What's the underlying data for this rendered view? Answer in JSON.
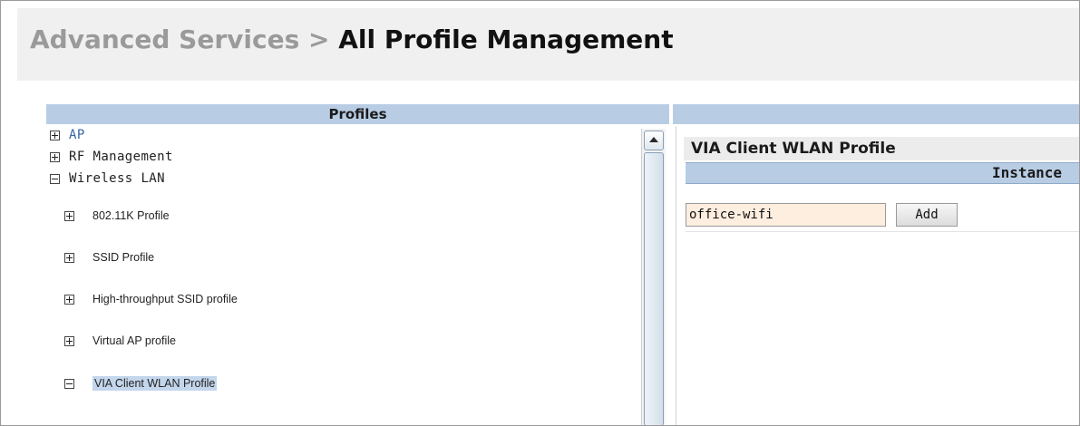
{
  "header": {
    "breadcrumb_parent": "Advanced Services",
    "breadcrumb_separator": ">",
    "breadcrumb_current": "All Profile Management"
  },
  "profiles": {
    "header": "Profiles",
    "tree": [
      {
        "label": "AP",
        "state": "collapsed",
        "level": 0,
        "link": true
      },
      {
        "label": "RF Management",
        "state": "collapsed",
        "level": 0
      },
      {
        "label": "Wireless LAN",
        "state": "expanded",
        "level": 0
      },
      {
        "label": "802.11K Profile",
        "state": "collapsed",
        "level": 1
      },
      {
        "label": "SSID Profile",
        "state": "collapsed",
        "level": 1
      },
      {
        "label": "High-throughput SSID profile",
        "state": "collapsed",
        "level": 1
      },
      {
        "label": "Virtual AP profile",
        "state": "collapsed",
        "level": 1
      },
      {
        "label": "VIA Client WLAN Profile",
        "state": "expanded",
        "level": 1,
        "selected": true
      }
    ]
  },
  "detail": {
    "title": "VIA Client WLAN Profile",
    "instance_header": "Instance",
    "instance_input_value": "office-wifi",
    "add_label": "Add"
  },
  "colors": {
    "header_band": "#b8cde4",
    "input_bg": "#fdeee0",
    "link": "#3465a4",
    "muted": "#9a9a9a",
    "selection": "#c3d6ec"
  }
}
